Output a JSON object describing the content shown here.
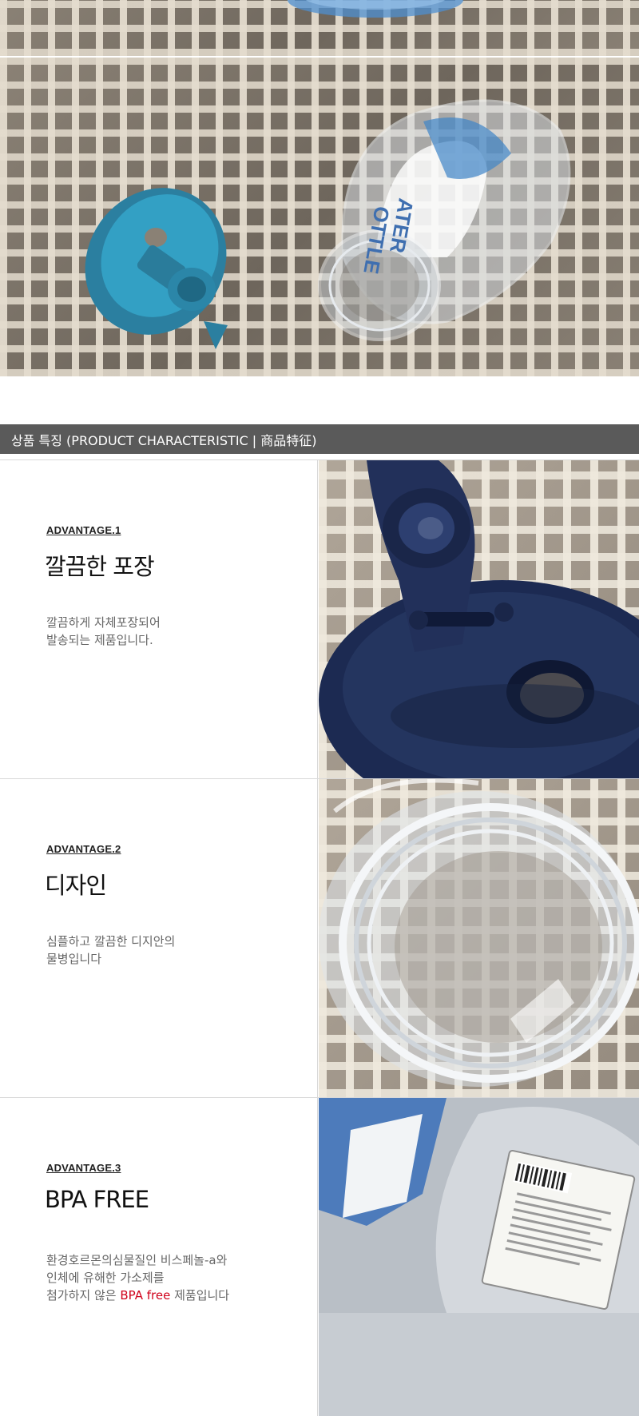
{
  "header": {
    "title": "상품 특징 (PRODUCT CHARACTERISTIC | 商品特征)"
  },
  "top_photo": {
    "bottle_label_fragments": [
      "ATER",
      "OTTLE"
    ]
  },
  "advantages": [
    {
      "label": "ADVANTAGE.1",
      "title": "깔끔한 포장",
      "desc": [
        "깔끔하게 자체포장되어",
        "발송되는 제품입니다."
      ]
    },
    {
      "label": "ADVANTAGE.2",
      "title": "디자인",
      "desc": [
        "심플하고 깔끔한 디지안의",
        "물병입니다"
      ]
    },
    {
      "label": "ADVANTAGE.3",
      "title": "BPA FREE",
      "desc_lines": [
        "환경호르몬의심물질인 비스페놀-a와",
        "인체에 유해한 가소제를"
      ],
      "desc_last_prefix": "첨가하지 않은 ",
      "desc_last_highlight": "BPA free",
      "desc_last_suffix": " 제품입니다"
    }
  ],
  "colors": {
    "header_bg": "#5a5a5a",
    "lid_teal": "#2b7fa0",
    "lid_navy": "#1c2a52",
    "highlight_red": "#d0021b"
  }
}
